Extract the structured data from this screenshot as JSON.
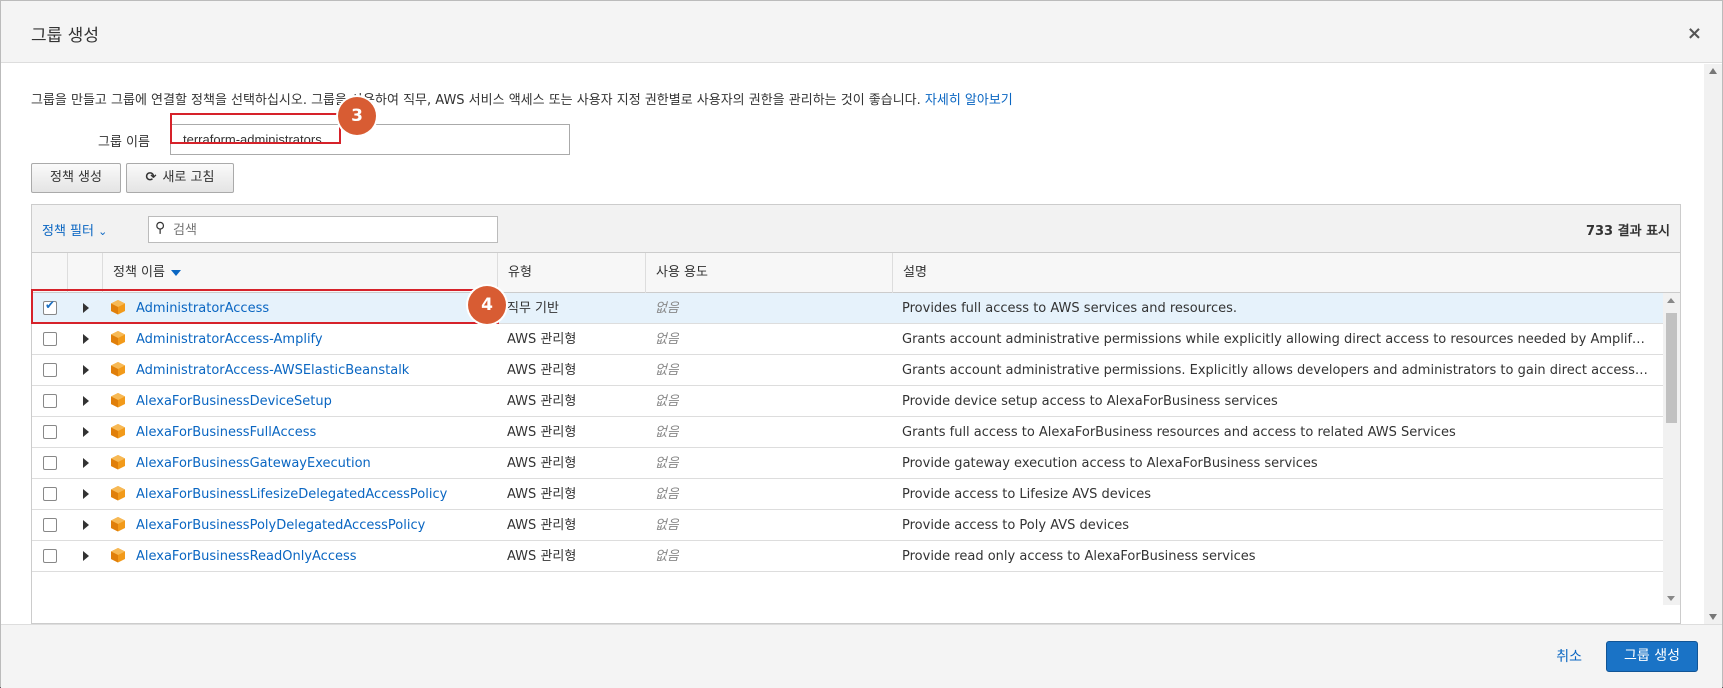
{
  "dialog": {
    "title": "그룹 생성",
    "close_glyph": "×"
  },
  "intro": {
    "text": "그룹을 만들고 그룹에 연결할 정책을 선택하십시오. 그룹을 사용하여 직무, AWS 서비스 액세스 또는 사용자 지정 권한별로 사용자의 권한을 관리하는 것이 좋습니다. ",
    "link": "자세히 알아보기"
  },
  "group_name": {
    "label": "그룹 이름",
    "value": "terraform-administrators"
  },
  "annotations": {
    "step3": "3",
    "step4": "4"
  },
  "buttons": {
    "create_policy": "정책 생성",
    "refresh": "새로 고침"
  },
  "table": {
    "filter_label": "정책 필터",
    "search_placeholder": "검색",
    "result_count": "733 결과 표시",
    "headers": {
      "name": "정책 이름",
      "type": "유형",
      "usage": "사용 용도",
      "description": "설명"
    },
    "rows": [
      {
        "checked": true,
        "name": "AdministratorAccess",
        "type": "직무 기반",
        "usage": "없음",
        "description": "Provides full access to AWS services and resources."
      },
      {
        "checked": false,
        "name": "AdministratorAccess-Amplify",
        "type": "AWS 관리형",
        "usage": "없음",
        "description": "Grants account administrative permissions while explicitly allowing direct access to resources needed by Amplify applic..."
      },
      {
        "checked": false,
        "name": "AdministratorAccess-AWSElasticBeanstalk",
        "type": "AWS 관리형",
        "usage": "없음",
        "description": "Grants account administrative permissions. Explicitly allows developers and administrators to gain direct access to res..."
      },
      {
        "checked": false,
        "name": "AlexaForBusinessDeviceSetup",
        "type": "AWS 관리형",
        "usage": "없음",
        "description": "Provide device setup access to AlexaForBusiness services"
      },
      {
        "checked": false,
        "name": "AlexaForBusinessFullAccess",
        "type": "AWS 관리형",
        "usage": "없음",
        "description": "Grants full access to AlexaForBusiness resources and access to related AWS Services"
      },
      {
        "checked": false,
        "name": "AlexaForBusinessGatewayExecution",
        "type": "AWS 관리형",
        "usage": "없음",
        "description": "Provide gateway execution access to AlexaForBusiness services"
      },
      {
        "checked": false,
        "name": "AlexaForBusinessLifesizeDelegatedAccessPolicy",
        "type": "AWS 관리형",
        "usage": "없음",
        "description": "Provide access to Lifesize AVS devices"
      },
      {
        "checked": false,
        "name": "AlexaForBusinessPolyDelegatedAccessPolicy",
        "type": "AWS 관리형",
        "usage": "없음",
        "description": "Provide access to Poly AVS devices"
      },
      {
        "checked": false,
        "name": "AlexaForBusinessReadOnlyAccess",
        "type": "AWS 관리형",
        "usage": "없음",
        "description": "Provide read only access to AlexaForBusiness services"
      }
    ]
  },
  "footer": {
    "cancel": "취소",
    "create_group": "그룹 생성"
  },
  "colors": {
    "link": "#0a66c2",
    "highlight": "#d6222a",
    "badge": "#d85c33",
    "primary_button": "#1a73c6",
    "policy_icon": "#f29a1a"
  }
}
